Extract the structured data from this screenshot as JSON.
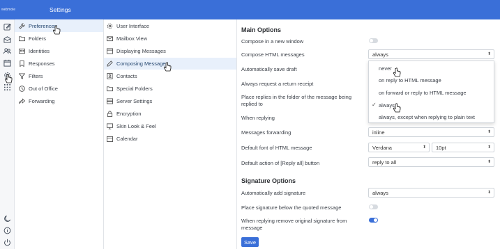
{
  "header": {
    "brand": "webmole",
    "title": "Settings"
  },
  "rail": {
    "top_icons": [
      "compose-icon",
      "mail-icon",
      "contacts-icon",
      "calendar-icon",
      "settings-icon",
      "apps-icon"
    ],
    "bottom_icons": [
      "dark-mode-icon",
      "info-icon",
      "logout-icon"
    ]
  },
  "sections": [
    {
      "label": "Preferences",
      "icon": "wrench-icon",
      "selected": true
    },
    {
      "label": "Folders",
      "icon": "folder-icon"
    },
    {
      "label": "Identities",
      "icon": "identity-card-icon"
    },
    {
      "label": "Responses",
      "icon": "bookmark-icon"
    },
    {
      "label": "Filters",
      "icon": "filter-icon"
    },
    {
      "label": "Out of Office",
      "icon": "clock-icon"
    },
    {
      "label": "Forwarding",
      "icon": "share-icon"
    }
  ],
  "prefs": [
    {
      "label": "User Interface",
      "icon": "cog-icon"
    },
    {
      "label": "Mailbox View",
      "icon": "envelope-icon"
    },
    {
      "label": "Displaying Messages",
      "icon": "display-icon"
    },
    {
      "label": "Composing Messages",
      "icon": "pencil-icon",
      "selected": true
    },
    {
      "label": "Contacts",
      "icon": "contact-icon"
    },
    {
      "label": "Special Folders",
      "icon": "folder-icon"
    },
    {
      "label": "Server Settings",
      "icon": "server-icon"
    },
    {
      "label": "Encryption",
      "icon": "lock-icon"
    },
    {
      "label": "Skin Look & Feel",
      "icon": "monitor-icon"
    },
    {
      "label": "Calendar",
      "icon": "calendar-icon"
    }
  ],
  "main": {
    "main_options_title": "Main Options",
    "compose_new_window": {
      "label": "Compose in a new window",
      "on": false
    },
    "compose_html": {
      "label": "Compose HTML messages",
      "value": "always"
    },
    "auto_save_draft": {
      "label": "Automatically save draft"
    },
    "return_receipt": {
      "label": "Always request a return receipt"
    },
    "replies_folder": {
      "label": "Place replies in the folder of the message being replied to"
    },
    "when_replying": {
      "label": "When replying"
    },
    "messages_forwarding": {
      "label": "Messages forwarding",
      "value": "inline"
    },
    "default_font": {
      "label": "Default font of HTML message",
      "font": "Verdana",
      "size": "10pt"
    },
    "reply_all": {
      "label": "Default action of [Reply all] button",
      "value": "reply to all"
    },
    "signature_title": "Signature Options",
    "auto_add_signature": {
      "label": "Automatically add signature",
      "value": "always"
    },
    "signature_below": {
      "label": "Place signature below the quoted message",
      "on": false
    },
    "remove_signature": {
      "label": "When replying remove original signature from message",
      "on": true
    },
    "save_label": "Save"
  },
  "dropdown": {
    "options": [
      "never",
      "on reply to HTML message",
      "on forward or reply to HTML message",
      "always",
      "always, except when replying to plain text"
    ],
    "selected_index": 3
  },
  "colors": {
    "accent": "#3a6fd8",
    "selection": "#e8f0fb"
  }
}
